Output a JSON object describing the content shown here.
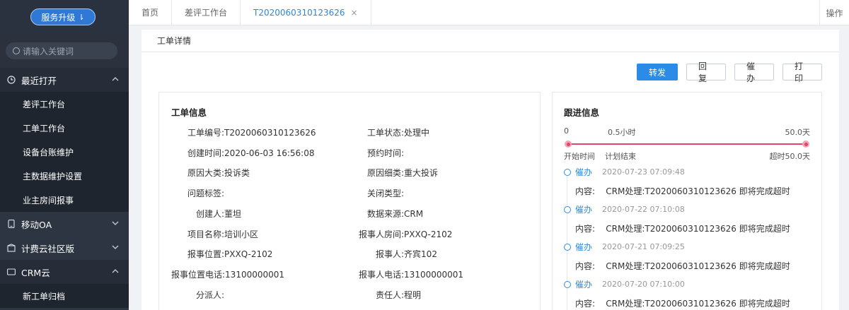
{
  "sidebar": {
    "upgrade_label": "服务升级",
    "search_placeholder": "请输入关键词",
    "groups": [
      {
        "label": "最近打开",
        "icon": "clock-icon",
        "open": true,
        "items": [
          "差评工作台",
          "工单工作台",
          "设备台账维护",
          "主数据维护设置",
          "业主房间报事"
        ]
      },
      {
        "label": "移动OA",
        "icon": "mobile-icon",
        "open": false
      },
      {
        "label": "计费云社区版",
        "icon": "building-icon",
        "open": false
      },
      {
        "label": "CRM云",
        "icon": "crm-icon",
        "open": true,
        "items": [
          "新工单归档"
        ]
      }
    ]
  },
  "tabs": [
    {
      "label": "首页"
    },
    {
      "label": "差评工作台"
    },
    {
      "label": "T2020060310123626",
      "active": true
    }
  ],
  "topbar": {
    "ops_label": "操作"
  },
  "main": {
    "title": "工单详情",
    "actions": {
      "forward": "转发",
      "reply": "回复",
      "urge": "催办",
      "print": "打印"
    },
    "info": {
      "title": "工单信息",
      "fields": {
        "order_no": "工单编号:T2020060310123626",
        "status": "工单状态:处理中",
        "created": "创建时间:2020-06-03 16:56:08",
        "appointment": "预约时间:",
        "reason_major": "原因大类:投诉类",
        "reason_minor": "原因细类:重大投诉",
        "issue_tag": "问题标签:",
        "close_type": "关闭类型:",
        "creator": "创建人:董坦",
        "source": "数据来源:CRM",
        "project": "项目名称:培训小区",
        "reporter_room": "报事人房间:PXXQ-2102",
        "location": "报事位置:PXXQ-2102",
        "reporter": "报事人:齐宾102",
        "location_phone": "报事位置电话:13100000001",
        "reporter_phone": "报事人电话:13100000001",
        "dispatcher": "分派人:",
        "responsible": "责任人:程明"
      }
    },
    "follow": {
      "title": "跟进信息",
      "scale": {
        "start": "0",
        "mid": "0.5小时",
        "end": "50.0天"
      },
      "progress_labels": {
        "start": "开始时间",
        "plan_end": "计划结束",
        "overtime": "超时50.0天"
      },
      "timeline": [
        {
          "type": "催办",
          "time": "2020-07-23 07:09:48",
          "content": "内容:    CRM处理:T2020060310123626 即将完成超时"
        },
        {
          "type": "催办",
          "time": "2020-07-22 07:10:08",
          "content": "内容:    CRM处理:T2020060310123626 即将完成超时"
        },
        {
          "type": "催办",
          "time": "2020-07-21 07:09:25",
          "content": "内容:    CRM处理:T2020060310123626 即将完成超时"
        },
        {
          "type": "催办",
          "time": "2020-07-20 07:10:00",
          "content": "内容:    CRM处理:T2020060310123626 即将完成超时"
        }
      ]
    }
  },
  "colors": {
    "accent": "#2b8be6",
    "sidebar_bg": "#2d3542",
    "progress": "#e0456a"
  }
}
